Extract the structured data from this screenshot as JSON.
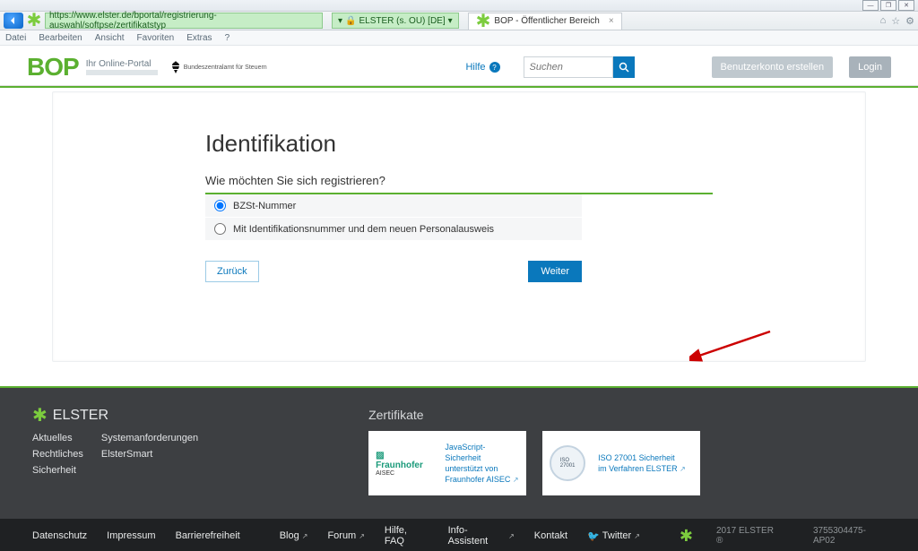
{
  "window": {
    "url": "https://www.elster.de/bportal/registrierung-auswahl/softpse/zertifikatstyp",
    "ssl": "ELSTER (s. OU) [DE]",
    "tab_title": "BOP - Öffentlicher Bereich"
  },
  "menus": [
    "Datei",
    "Bearbeiten",
    "Ansicht",
    "Favoriten",
    "Extras",
    "?"
  ],
  "header": {
    "logo": "BOP",
    "subtitle": "Ihr Online-Portal",
    "ministry": "Bundeszentralamt für Steuern",
    "help": "Hilfe",
    "search_placeholder": "Suchen",
    "create_account": "Benutzerkonto erstellen",
    "login": "Login"
  },
  "main": {
    "title": "Identifikation",
    "question": "Wie möchten Sie sich registrieren?",
    "options": [
      {
        "label": "BZSt-Nummer",
        "selected": true
      },
      {
        "label": "Mit Identifikationsnummer und dem neuen Personalausweis",
        "selected": false
      }
    ],
    "back": "Zurück",
    "next": "Weiter"
  },
  "footer": {
    "brand": "ELSTER",
    "links": [
      "Aktuelles",
      "Systemanforderungen",
      "Rechtliches",
      "ElsterSmart",
      "Sicherheit"
    ],
    "cert_title": "Zertifikate",
    "cert1_name": "Fraunhofer",
    "cert1_sub": "AISEC",
    "cert1_text_l1": "JavaScript-Sicherheit",
    "cert1_text_l2": "unterstützt von",
    "cert1_text_l3": "Fraunhofer AISEC",
    "cert2_text_l1": "ISO 27001 Sicherheit",
    "cert2_text_l2": "im Verfahren ELSTER",
    "bottom": [
      "Datenschutz",
      "Impressum",
      "Barrierefreiheit"
    ],
    "bottom_center": [
      "Blog",
      "Forum",
      "Hilfe, FAQ",
      "Info-Assistent",
      "Kontakt",
      "Twitter"
    ],
    "copyright": "2017 ELSTER ®",
    "build_id": "3755304475-AP02"
  }
}
